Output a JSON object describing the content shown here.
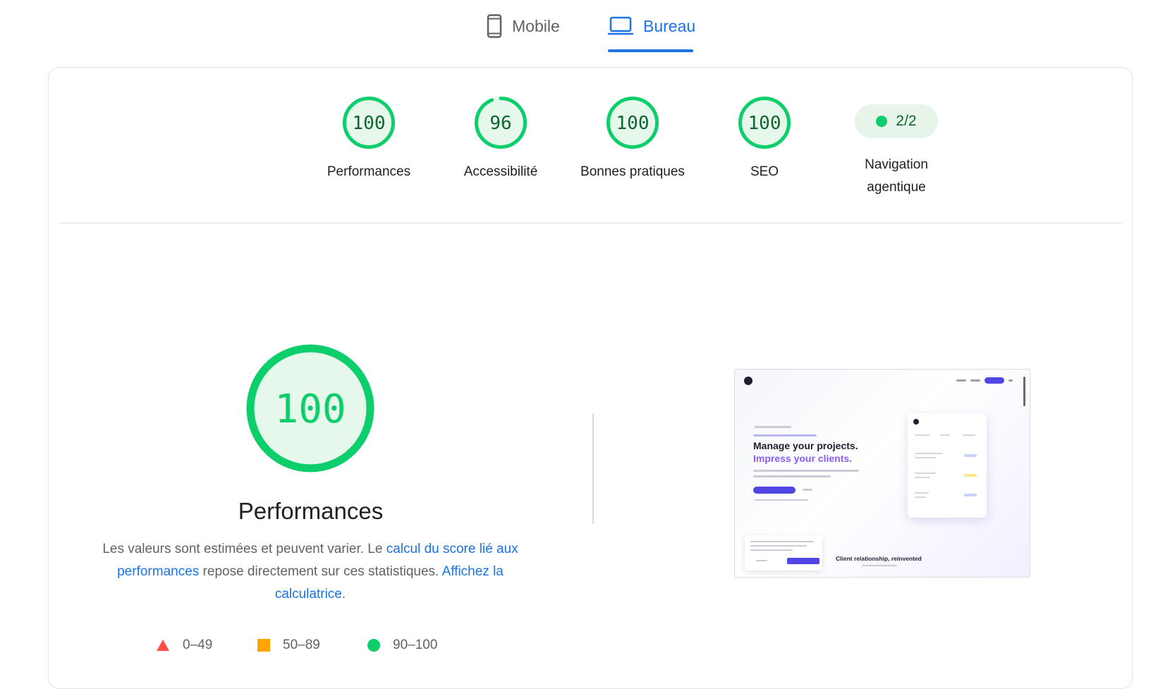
{
  "tabs": [
    {
      "label": "Mobile",
      "icon": "smartphone-icon",
      "active": false
    },
    {
      "label": "Bureau",
      "icon": "laptop-icon",
      "active": true
    }
  ],
  "colors": {
    "pass": "#0cce6b",
    "pass_text": "#0d652d",
    "pass_bg": "#e6f4ea",
    "average": "#ffa400",
    "fail": "#ff4e42",
    "link": "#1a73e8"
  },
  "gauges": [
    {
      "label": "Performances",
      "score": "100",
      "value": 100
    },
    {
      "label": "Accessibilité",
      "score": "96",
      "value": 96
    },
    {
      "label": "Bonnes pratiques",
      "score": "100",
      "value": 100
    },
    {
      "label": "SEO",
      "score": "100",
      "value": 100
    }
  ],
  "navigation": {
    "value": "2/2",
    "label_line1": "Navigation",
    "label_line2": "agentique"
  },
  "performance": {
    "score": "100",
    "value": 100,
    "title": "Performances",
    "desc_1": "Les valeurs sont estimées et peuvent varier. Le ",
    "link_1": "calcul du score lié aux performances",
    "desc_2": " repose directement sur ces statistiques. ",
    "link_2": "Affichez la calculatrice",
    "desc_3": "."
  },
  "legend": [
    {
      "range": "0–49",
      "shape": "triangle",
      "color": "#ff4e42"
    },
    {
      "range": "50–89",
      "shape": "square",
      "color": "#ffa400"
    },
    {
      "range": "90–100",
      "shape": "circle",
      "color": "#0cce6b"
    }
  ],
  "preview": {
    "headline_1": "Manage your projects.",
    "headline_2": "Impress your clients.",
    "footer_text": "Client relationship, reinvented"
  }
}
